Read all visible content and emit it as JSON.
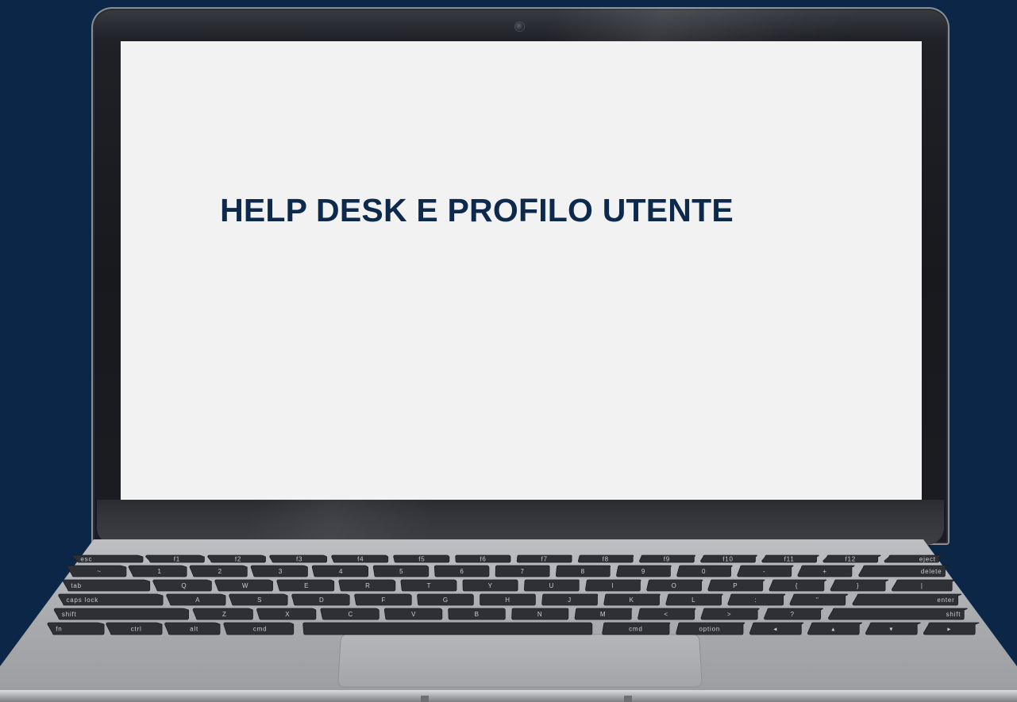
{
  "screen": {
    "title": "HELP DESK E PROFILO UTENTE"
  },
  "keyboard": {
    "function_row": [
      "esc",
      "f1",
      "f2",
      "f3",
      "f4",
      "f5",
      "f6",
      "f7",
      "f8",
      "f9",
      "f10",
      "f11",
      "f12",
      "eject"
    ],
    "number_row": [
      "~",
      "1",
      "2",
      "3",
      "4",
      "5",
      "6",
      "7",
      "8",
      "9",
      "0",
      "-",
      "+",
      "delete"
    ],
    "top_row": [
      "tab",
      "Q",
      "W",
      "E",
      "R",
      "T",
      "Y",
      "U",
      "I",
      "O",
      "P",
      "{",
      "}",
      "|"
    ],
    "home_row": [
      "caps lock",
      "A",
      "S",
      "D",
      "F",
      "G",
      "H",
      "J",
      "K",
      "L",
      ":",
      "\"",
      "enter"
    ],
    "shift_row": [
      "shift",
      "Z",
      "X",
      "C",
      "V",
      "B",
      "N",
      "M",
      "<",
      ">",
      "?",
      "shift"
    ],
    "bottom_row": [
      "fn",
      "ctrl",
      "alt",
      "cmd",
      "",
      "cmd",
      "option",
      "◂",
      "▴",
      "▾",
      "▸"
    ]
  },
  "colors": {
    "background": "#0b2646",
    "screen": "#f2f2f2",
    "title": "#0d2a4c",
    "keys": "#2e3035",
    "deck": "#a9abae"
  }
}
